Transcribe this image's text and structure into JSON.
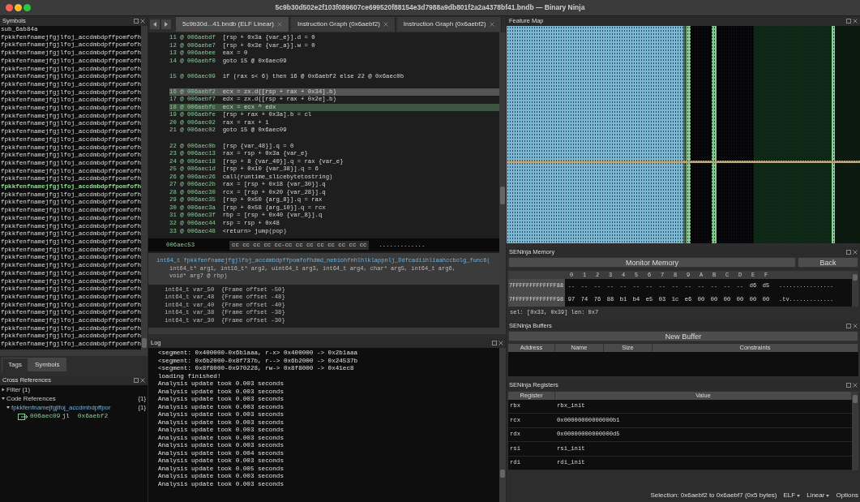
{
  "window": {
    "title": "5c9b30d502e2f103f089607ce699520f88154e3d7988a9db801f2a2a4378bf41.bndb — Binary Ninja"
  },
  "symbols": {
    "title": "Symbols",
    "items": [
      {
        "name": "sub_6ab84a",
        "selected": false
      },
      {
        "name": "fpkkfenfnamejfgjlfoj_accdmbdpffpomfofh",
        "selected": false
      },
      {
        "name": "fpkkfenfnamejfgjlfoj_accdmbdpffpomfofh",
        "selected": false
      },
      {
        "name": "fpkkfenfnamejfgjlfoj_accdmbdpffpomfofh",
        "selected": false
      },
      {
        "name": "fpkkfenfnamejfgjlfoj_accdmbdpffpomfofh",
        "selected": false
      },
      {
        "name": "fpkkfenfnamejfgjlfoj_accdmbdpffpomfofh",
        "selected": false
      },
      {
        "name": "fpkkfenfnamejfgjlfoj_accdmbdpffpomfofh",
        "selected": false
      },
      {
        "name": "fpkkfenfnamejfgjlfoj_accdmbdpffpomfofh",
        "selected": false
      },
      {
        "name": "fpkkfenfnamejfgjlfoj_accdmbdpffpomfofh",
        "selected": false
      },
      {
        "name": "fpkkfenfnamejfgjlfoj_accdmbdpffpomfofh",
        "selected": false
      },
      {
        "name": "fpkkfenfnamejfgjlfoj_accdmbdpffpomfofh",
        "selected": false
      },
      {
        "name": "fpkkfenfnamejfgjlfoj_accdmbdpffpomfofh",
        "selected": false
      },
      {
        "name": "fpkkfenfnamejfgjlfoj_accdmbdpffpomfofh",
        "selected": false
      },
      {
        "name": "fpkkfenfnamejfgjlfoj_accdmbdpffpomfofh",
        "selected": false
      },
      {
        "name": "fpkkfenfnamejfgjlfoj_accdmbdpffpomfofh",
        "selected": false
      },
      {
        "name": "fpkkfenfnamejfgjlfoj_accdmbdpffpomfofh",
        "selected": false
      },
      {
        "name": "fpkkfenfnamejfgjlfoj_accdmbdpffpomfofh",
        "selected": false
      },
      {
        "name": "fpkkfenfnamejfgjlfoj_accdmbdpffpomfofh",
        "selected": false
      },
      {
        "name": "fpkkfenfnamejfgjlfoj_accdmbdpffpomfofh",
        "selected": false
      },
      {
        "name": "fpkkfenfnamejfgjlfoj_accdmbdpffpomfofh",
        "selected": false
      },
      {
        "name": "fpkkfenfnamejfgjlfoj_accdmbdpffpomfofh",
        "selected": true
      },
      {
        "name": "fpkkfenfnamejfgjlfoj_accdmbdpffpomfofh",
        "selected": false
      },
      {
        "name": "fpkkfenfnamejfgjlfoj_accdmbdpffpomfofh",
        "selected": false
      },
      {
        "name": "fpkkfenfnamejfgjlfoj_accdmbdpffpomfofh",
        "selected": false
      },
      {
        "name": "fpkkfenfnamejfgjlfoj_accdmbdpffpomfofh",
        "selected": false
      },
      {
        "name": "fpkkfenfnamejfgjlfoj_accdmbdpffpomfofh",
        "selected": false
      },
      {
        "name": "fpkkfenfnamejfgjlfoj_accdmbdpffpomfofh",
        "selected": false
      },
      {
        "name": "fpkkfenfnamejfgjlfoj_accdmbdpffpomfofh",
        "selected": false
      },
      {
        "name": "fpkkfenfnamejfgjlfoj_accdmbdpffpomfofh",
        "selected": false
      },
      {
        "name": "fpkkfenfnamejfgjlfoj_accdmbdpffpomfofh",
        "selected": false
      },
      {
        "name": "fpkkfenfnamejfgjlfoj_accdmbdpffpomfofh",
        "selected": false
      },
      {
        "name": "fpkkfenfnamejfgjlfoj_accdmbdpffpomfofh",
        "selected": false
      },
      {
        "name": "fpkkfenfnamejfgjlfoj_accdmbdpffpomfofh",
        "selected": false
      },
      {
        "name": "fpkkfenfnamejfgjlfoj_accdmbdpffpomfofh",
        "selected": false
      },
      {
        "name": "fpkkfenfnamejfgjlfoj_accdmbdpffpomfofh",
        "selected": false
      },
      {
        "name": "fpkkfenfnamejfgjlfoj_accdmbdpffpomfofh",
        "selected": false
      },
      {
        "name": "fpkkfenfnamejfgjlfoj_accdmbdpffpomfofh",
        "selected": false
      },
      {
        "name": "fpkkfenfnamejfgjlfoj_accdmbdpffpomfofh",
        "selected": false
      },
      {
        "name": "fpkkfenfnamejfgjlfoj_accdmbdpffpomfofh",
        "selected": false
      },
      {
        "name": "fpkkfenfnamejfgjlfoj_accdmbdpffpomfofh",
        "selected": false
      },
      {
        "name": "fpkkfenfnamejfgjlfoj_accdmbdpffpomfofh",
        "selected": false
      }
    ]
  },
  "left_tabs": [
    {
      "label": "Tags",
      "selected": false
    },
    {
      "label": "Symbols",
      "selected": true
    }
  ],
  "cross_references": {
    "title": "Cross References",
    "filter": "Filter (1)",
    "groups": [
      {
        "label": "Code References",
        "count": "{1}",
        "expanded": true,
        "children": [
          {
            "label": "fpkkfenfnamejfgjlfoj_accdmbdpffpor",
            "count": "{1}",
            "expanded": true,
            "children": [
              {
                "address": "006aec09",
                "mnemonic": "jl",
                "target": "0x6aebf2"
              }
            ]
          }
        ]
      }
    ]
  },
  "editor": {
    "tabs": [
      {
        "label": "5c9b30d...41.bndb (ELF Linear)",
        "selected": true
      },
      {
        "label": "Instruction Graph (0x6aebf2)",
        "selected": false
      },
      {
        "label": "Instruction Graph (0x6aebf2)",
        "selected": false
      }
    ],
    "lines": [
      {
        "location": "11 @ 006aebdf",
        "code": "[rsp + 0x3a {var_e}].d = 0",
        "selected": false,
        "current": false,
        "gap_before": false
      },
      {
        "location": "12 @ 006aebe7",
        "code": "[rsp + 0x3e {var_a}].w = 0",
        "selected": false,
        "current": false,
        "gap_before": false
      },
      {
        "location": "13 @ 006aebee",
        "code": "eax = 0",
        "selected": false,
        "current": false,
        "gap_before": false
      },
      {
        "location": "14 @ 006aebf0",
        "code": "goto 15 @ 0x6aec09",
        "selected": false,
        "current": false,
        "gap_before": false
      },
      {
        "location": "15 @ 006aec09",
        "code": "if (rax s< 6) then 16 @ 0x6aebf2 else 22 @ 0x6aec0b",
        "selected": false,
        "current": false,
        "gap_before": true
      },
      {
        "location": "16 @ 006aebf2",
        "code": "ecx = zx.d([rsp + rax + 0x34].b)",
        "selected": true,
        "current": false,
        "gap_before": true
      },
      {
        "location": "17 @ 006aebf7",
        "code": "edx = zx.d([rsp + rax + 0x2e].b)",
        "selected": false,
        "current": false,
        "gap_before": false
      },
      {
        "location": "18 @ 006aebfc",
        "code": "ecx = ecx ^ edx",
        "selected": false,
        "current": true,
        "gap_before": false
      },
      {
        "location": "19 @ 006aebfe",
        "code": "[rsp + rax + 0x3a].b = cl",
        "selected": false,
        "current": false,
        "gap_before": false
      },
      {
        "location": "20 @ 006aec02",
        "code": "rax = rax + 1",
        "selected": false,
        "current": false,
        "gap_before": false
      },
      {
        "location": "21 @ 006aec02",
        "code": "goto 15 @ 0x6aec09",
        "selected": false,
        "current": false,
        "gap_before": false
      },
      {
        "location": "22 @ 006aec0b",
        "code": "[rsp {var_48}].q = 0",
        "selected": false,
        "current": false,
        "gap_before": true
      },
      {
        "location": "23 @ 006aec13",
        "code": "rax = rsp + 0x3a {var_e}",
        "selected": false,
        "current": false,
        "gap_before": false
      },
      {
        "location": "24 @ 006aec18",
        "code": "[rsp + 8 {var_40}].q = rax {var_e}",
        "selected": false,
        "current": false,
        "gap_before": false
      },
      {
        "location": "25 @ 006aec1d",
        "code": "[rsp + 0x10 {var_38}].q = 6",
        "selected": false,
        "current": false,
        "gap_before": false
      },
      {
        "location": "26 @ 006aec26",
        "code": "call(runtime_slicebytetostring)",
        "selected": false,
        "current": false,
        "gap_before": false
      },
      {
        "location": "27 @ 006aec2b",
        "code": "rax = [rsp + 0x18 {var_30}].q",
        "selected": false,
        "current": false,
        "gap_before": false
      },
      {
        "location": "28 @ 006aec30",
        "code": "rcx = [rsp + 0x20 {var_28}].q",
        "selected": false,
        "current": false,
        "gap_before": false
      },
      {
        "location": "29 @ 006aec35",
        "code": "[rsp + 0x50 {arg_8}].q = rax",
        "selected": false,
        "current": false,
        "gap_before": false
      },
      {
        "location": "30 @ 006aec3a",
        "code": "[rsp + 0x58 {arg_10}].q = rcx",
        "selected": false,
        "current": false,
        "gap_before": false
      },
      {
        "location": "31 @ 006aec3f",
        "code": "rbp = [rsp + 0x40 {var_8}].q",
        "selected": false,
        "current": false,
        "gap_before": false
      },
      {
        "location": "32 @ 006aec44",
        "code": "rsp = rsp + 0x48",
        "selected": false,
        "current": false,
        "gap_before": false
      },
      {
        "location": "33 @ 006aec48",
        "code": "<return> jump(pop)",
        "selected": false,
        "current": false,
        "gap_before": false
      }
    ],
    "hex_row": {
      "address": "006aec53",
      "bytes": "cc cc cc cc cc-cc cc cc cc cc cc cc cc",
      "ascii": "............."
    },
    "signature": [
      "int64_t fpkkfenfnamejfgjlfoj_accdmbdpffpomfofhdmd_nebiohfnhlhlklappnlj_Ddfcadiihliaahccbolg_func6(",
      "int64_t* arg1, int16_t* arg2, uint64_t arg3, int64_t arg4, char* arg5, int64_t arg6,",
      "void* arg7 @ rbp)"
    ],
    "variables": [
      "int64_t var_50  {Frame offset -50}",
      "int64_t var_48  {Frame offset -48}",
      "int64_t var_40  {Frame offset -40}",
      "int64_t var_38  {Frame offset -38}",
      "int64_t var_30  {Frame offset -30}"
    ]
  },
  "log": {
    "title": "Log",
    "lines": [
      "<segment: 0x400000-0x6b1aaa, r-x> 0x400000 -> 0x2b1aaa",
      "<segment: 0x6b2000-0x8f737b, r--> 0x6b2000 -> 0x24537b",
      "<segment: 0x8f8000-0x970228, rw-> 0x8f8000 -> 0x41ec8",
      "loading finished!",
      "Analysis update took 0.003 seconds",
      "Analysis update took 0.003 seconds",
      "Analysis update took 0.003 seconds",
      "Analysis update took 0.003 seconds",
      "Analysis update took 0.003 seconds",
      "Analysis update took 0.003 seconds",
      "Analysis update took 0.003 seconds",
      "Analysis update took 0.003 seconds",
      "Analysis update took 0.003 seconds",
      "Analysis update took 0.004 seconds",
      "Analysis update took 0.003 seconds",
      "Analysis update took 0.005 seconds",
      "Analysis update took 0.003 seconds",
      "Analysis update took 0.003 seconds"
    ]
  },
  "feature_map": {
    "title": "Feature Map"
  },
  "memory": {
    "title": "SENinja Memory",
    "buttons": [
      "Monitor Memory",
      "Back"
    ],
    "columns": [
      "0",
      "1",
      "2",
      "3",
      "4",
      "5",
      "6",
      "7",
      "8",
      "9",
      "A",
      "B",
      "C",
      "D",
      "E",
      "F"
    ],
    "rows": [
      {
        "address": "7FFFFFFFFFFFFF88",
        "bytes": [
          "..",
          "..",
          "..",
          "..",
          "..",
          "..",
          "..",
          "..",
          "..",
          "..",
          "..",
          "..",
          "..",
          "..",
          "d6",
          "d5"
        ],
        "ascii": "................"
      },
      {
        "address": "7FFFFFFFFFFFFF98",
        "bytes": [
          "97",
          "74",
          "76",
          "88",
          "b1",
          "b4",
          "e5",
          "03",
          "1c",
          "e6",
          "00",
          "00",
          "00",
          "00",
          "00",
          "00"
        ],
        "ascii": ".tv............."
      }
    ],
    "selection": "sel: [0x33, 0x39] len: 0x7"
  },
  "buffers": {
    "title": "SENinja Buffers",
    "button": "New Buffer",
    "columns": [
      "Address",
      "Name",
      "Size",
      "Constraints"
    ]
  },
  "registers": {
    "title": "SENinja Registers",
    "columns": [
      "Register",
      "Value"
    ],
    "rows": [
      {
        "register": "rbx",
        "value": "rbx_init"
      },
      {
        "register": "rcx",
        "value": "0x00000000000000b1"
      },
      {
        "register": "rdx",
        "value": "0x00000000000000d5"
      },
      {
        "register": "rsi",
        "value": "rsi_init"
      },
      {
        "register": "rdi",
        "value": "rdi_init"
      }
    ]
  },
  "status_bar": {
    "selection": "Selection: 0x6aebf2 to 0x6aebf7 (0x5 bytes)",
    "menus": [
      {
        "label": "ELF",
        "kind": "dropdown"
      },
      {
        "label": "Linear",
        "kind": "dropdown"
      },
      {
        "label": "Options",
        "kind": "plain"
      }
    ]
  }
}
